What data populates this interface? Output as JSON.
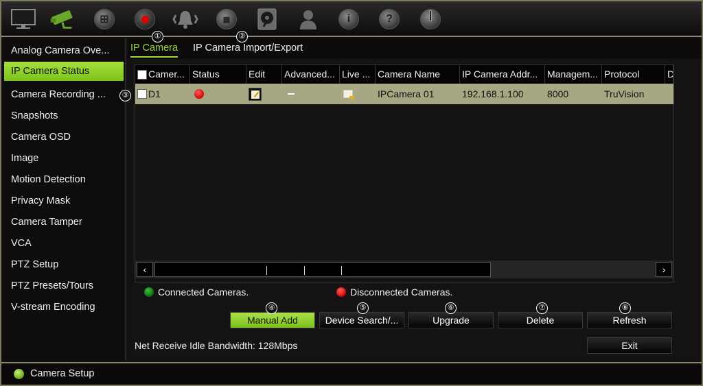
{
  "toolbar": {
    "icons": [
      {
        "name": "monitor-icon",
        "label": "Display"
      },
      {
        "name": "camera-icon",
        "label": "Camera Setup",
        "active": true
      },
      {
        "name": "network-icon",
        "label": "Network"
      },
      {
        "name": "record-icon",
        "label": "Recording"
      },
      {
        "name": "alarm-icon",
        "label": "Alarm"
      },
      {
        "name": "device-icon",
        "label": "Device"
      },
      {
        "name": "hdd-icon",
        "label": "Storage"
      },
      {
        "name": "user-icon",
        "label": "User"
      },
      {
        "name": "info-icon",
        "label": "Information"
      },
      {
        "name": "help-icon",
        "label": "Help"
      },
      {
        "name": "power-icon",
        "label": "Shutdown"
      }
    ]
  },
  "callouts": [
    "①",
    "②",
    "③",
    "④",
    "⑤",
    "⑥",
    "⑦",
    "⑧"
  ],
  "sidebar": {
    "items": [
      {
        "label": "Analog Camera Ove..."
      },
      {
        "label": "IP Camera Status",
        "active": true
      },
      {
        "label": "Camera Recording ..."
      },
      {
        "label": "Snapshots"
      },
      {
        "label": "Camera OSD"
      },
      {
        "label": "Image"
      },
      {
        "label": "Motion Detection"
      },
      {
        "label": "Privacy Mask"
      },
      {
        "label": "Camera Tamper"
      },
      {
        "label": "VCA"
      },
      {
        "label": "PTZ Setup"
      },
      {
        "label": "PTZ Presets/Tours"
      },
      {
        "label": "V-stream Encoding"
      }
    ]
  },
  "tabs": [
    {
      "label": "IP Camera",
      "active": true
    },
    {
      "label": "IP Camera Import/Export"
    }
  ],
  "table": {
    "columns": [
      "Camer...",
      "Status",
      "Edit",
      "Advanced...",
      "Live ...",
      "Camera Name",
      "IP Camera Addr...",
      "Managem...",
      "Protocol",
      "D"
    ],
    "rows": [
      {
        "camera": "D1",
        "status": "disconnected",
        "advanced": "—",
        "camera_name": "IPCamera 01",
        "ip_address": "192.168.1.100",
        "management_port": "8000",
        "protocol": "TruVision"
      }
    ]
  },
  "legend": {
    "connected": "Connected Cameras.",
    "disconnected": "Disconnected Cameras.",
    "colors": {
      "connected": "#0a8a0a",
      "disconnected": "#e00000"
    }
  },
  "buttons": {
    "manual_add": "Manual Add",
    "device_search": "Device Search/...",
    "upgrade": "Upgrade",
    "delete": "Delete",
    "refresh": "Refresh",
    "exit": "Exit"
  },
  "bandwidth": "Net Receive Idle Bandwidth: 128Mbps",
  "statusbar": {
    "title": "Camera Setup"
  },
  "scroll": {
    "left": "‹",
    "right": "›"
  },
  "accent": "#8ccf2a"
}
